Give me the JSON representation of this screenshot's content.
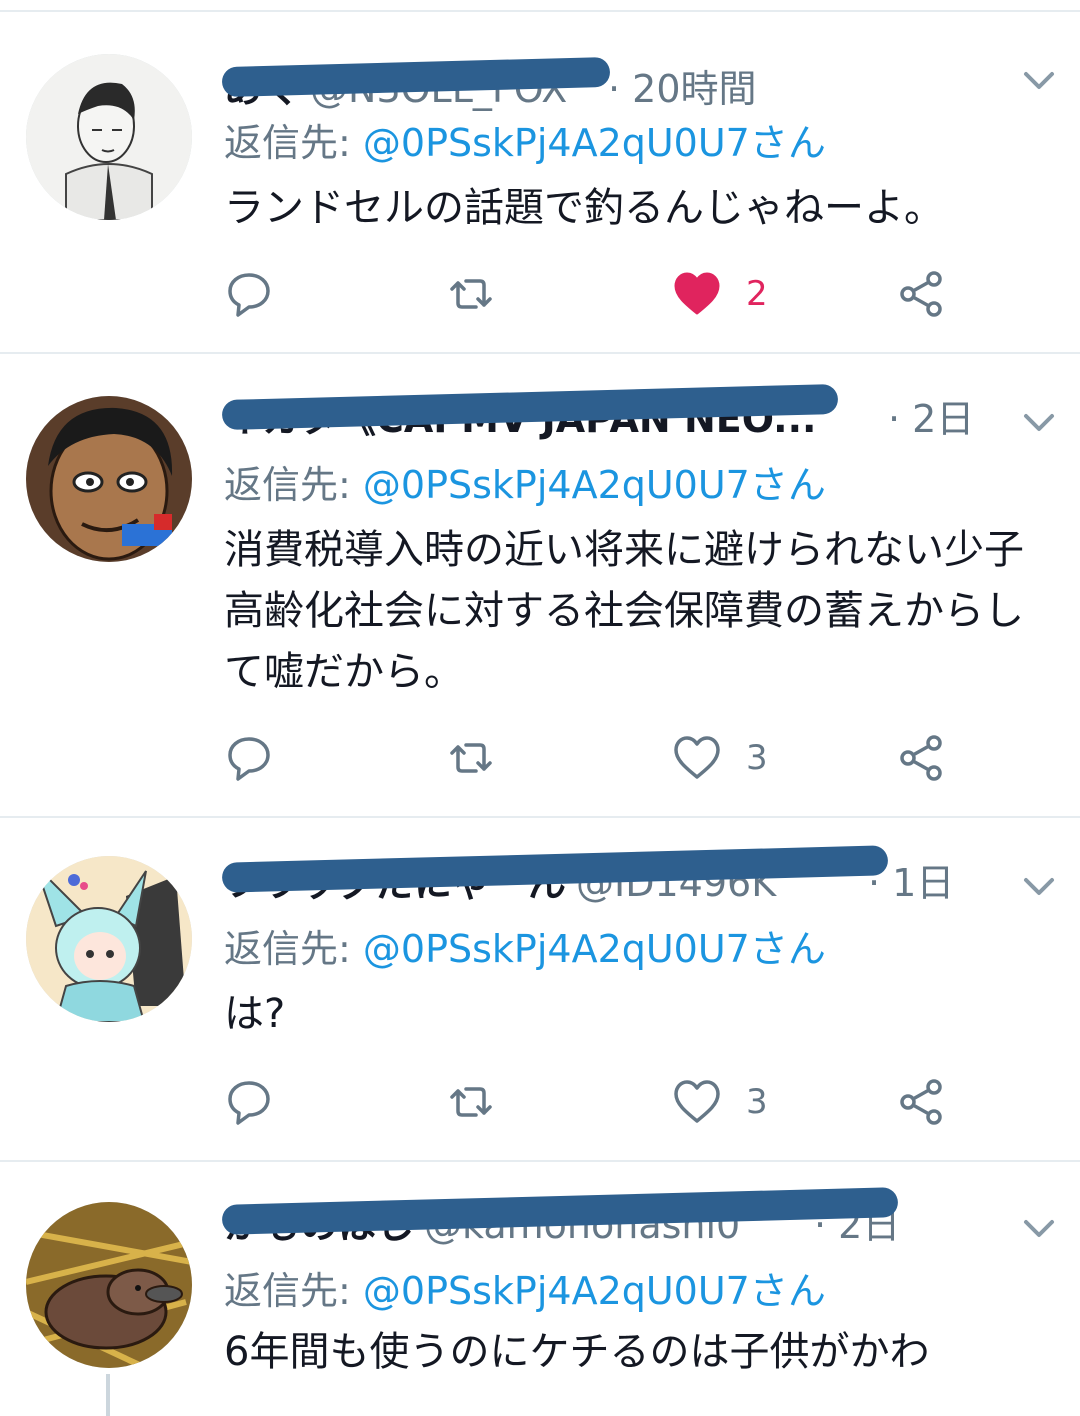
{
  "colors": {
    "accent": "#1b95e0",
    "muted": "#657786",
    "like": "#e0245e",
    "divider": "#e6ecf0",
    "scribble": "#2e5f8e"
  },
  "tweets": [
    {
      "name": "あく",
      "handle": "@N3OLL_FOX",
      "time": "· 20時間",
      "reply_label": "返信先:",
      "reply_mention": "@0PSskPj4A2qU0U7さん",
      "body": "ランドセルの話題で釣るんじゃねーよ。",
      "reply_count": "",
      "retweet_count": "",
      "like_count": "2",
      "liked": true
    },
    {
      "name": "イカタ《CAPMV JAPAN NEO...",
      "handle": "",
      "time": "· 2日",
      "reply_label": "返信先:",
      "reply_mention": "@0PSskPj4A2qU0U7さん",
      "body": "消費税導入時の近い将来に避けられない少子高齢化社会に対する社会保障費の蓄えからして嘘だから。",
      "reply_count": "",
      "retweet_count": "",
      "like_count": "3",
      "liked": false
    },
    {
      "name": "フラッグだにゃーん",
      "handle": "@ID1496K",
      "time": "· 1日",
      "reply_label": "返信先:",
      "reply_mention": "@0PSskPj4A2qU0U7さん",
      "body": "は?",
      "reply_count": "",
      "retweet_count": "",
      "like_count": "3",
      "liked": false
    },
    {
      "name": "かものはし",
      "handle": "@kamonohashi0",
      "time": "· 2日",
      "reply_label": "返信先:",
      "reply_mention": "@0PSskPj4A2qU0U7さん",
      "body": "6年間も使うのにケチるのは子供がかわ",
      "reply_count": "",
      "retweet_count": "",
      "like_count": "",
      "liked": false
    }
  ],
  "icons": {
    "reply": "reply-icon",
    "retweet": "retweet-icon",
    "like": "heart-icon",
    "share": "share-icon",
    "caret": "chevron-down-icon"
  }
}
